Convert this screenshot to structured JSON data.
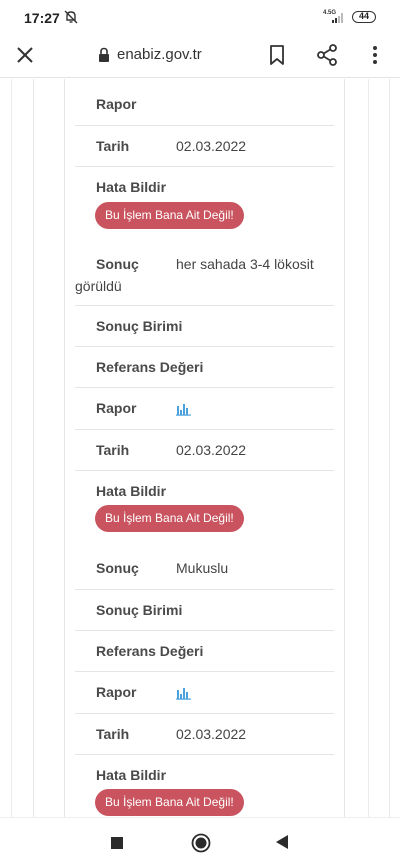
{
  "status_bar": {
    "time": "17:27",
    "network": "4.5G",
    "battery": "44"
  },
  "browser": {
    "url": "enabiz.gov.tr"
  },
  "labels": {
    "rapor": "Rapor",
    "tarih": "Tarih",
    "hata_bildir": "Hata Bildir",
    "sonuc": "Sonuç",
    "sonuc_birimi": "Sonuç Birimi",
    "referans_degeri": "Referans Değeri",
    "report_button": "Bu İşlem Bana Ait Değil!"
  },
  "records": [
    {
      "tarih": "02.03.2022"
    },
    {
      "sonuc": "her sahada 3-4 lökosit görüldü",
      "tarih": "02.03.2022"
    },
    {
      "sonuc": "Mukuslu",
      "tarih": "02.03.2022"
    }
  ],
  "colors": {
    "button": "#c9545f",
    "chart_icon": "#4aa3df"
  },
  "icons": [
    "close-icon",
    "lock-icon",
    "bookmark-icon",
    "share-icon",
    "more-vert-icon",
    "bar-chart-icon"
  ]
}
